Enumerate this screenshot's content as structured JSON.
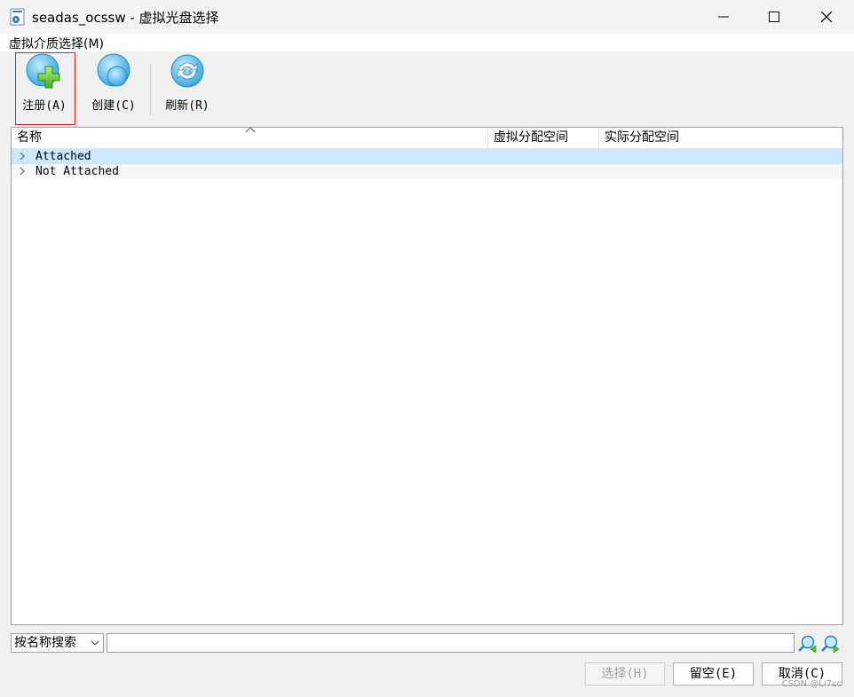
{
  "window": {
    "title": "seadas_ocssw - 虚拟光盘选择"
  },
  "menu": {
    "items": [
      {
        "label": "虚拟介质选择(M)"
      }
    ]
  },
  "toolbar": {
    "buttons": [
      {
        "label": "注册(A)",
        "icon": "add-disk-icon",
        "highlighted": true
      },
      {
        "label": "创建(C)",
        "icon": "create-disk-icon"
      },
      {
        "label": "刷新(R)",
        "icon": "refresh-icon"
      }
    ]
  },
  "list": {
    "columns": [
      "名称",
      "虚拟分配空间",
      "实际分配空间"
    ],
    "rows": [
      {
        "label": "Attached",
        "selected": true
      },
      {
        "label": "Not Attached",
        "selected": false
      }
    ]
  },
  "search": {
    "mode": "按名称搜索",
    "value": ""
  },
  "buttons": {
    "select": "选择(H)",
    "leave_empty": "留空(E)",
    "cancel": "取消(C)"
  },
  "watermark": "CSDN @Li7cc",
  "colors": {
    "selection": "#cce8ff",
    "highlight_border": "#e02020",
    "icon_blue": "#4fb3e8",
    "icon_green": "#5cc832"
  }
}
